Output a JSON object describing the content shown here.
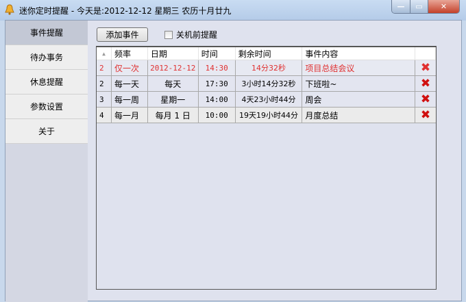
{
  "window": {
    "title": "迷你定时提醒 - 今天是:2012-12-12 星期三 农历十月廿九",
    "min": "—",
    "max": "▭",
    "close": "✕"
  },
  "sidebar": {
    "items": [
      {
        "label": "事件提醒",
        "active": true
      },
      {
        "label": "待办事务"
      },
      {
        "label": "休息提醒"
      },
      {
        "label": "参数设置"
      },
      {
        "label": "关于"
      }
    ]
  },
  "toolbar": {
    "add_label": "添加事件",
    "shutdown_label": "关机前提醒",
    "shutdown_checked": false
  },
  "table": {
    "headers": [
      "",
      "频率",
      "日期",
      "时间",
      "剩余时间",
      "事件内容",
      ""
    ],
    "rows": [
      {
        "id": "2",
        "freq": "仅一次",
        "date": "2012-12-12",
        "time": "14:30",
        "remain": "14分32秒",
        "content": "项目总结会议",
        "highlight": true
      },
      {
        "id": "2",
        "freq": "每一天",
        "date": "每天",
        "time": "17:30",
        "remain": "3小时14分32秒",
        "content": "下班啦~"
      },
      {
        "id": "3",
        "freq": "每一周",
        "date": "星期一",
        "time": "14:00",
        "remain": "4天23小时44分",
        "content": "周会"
      },
      {
        "id": "4",
        "freq": "每一月",
        "date": "每月 1 日",
        "time": "10:00",
        "remain": "19天19小时44分",
        "content": "月度总结"
      }
    ]
  },
  "colors": {
    "highlight": "#e03030",
    "delete": "#d01010"
  }
}
